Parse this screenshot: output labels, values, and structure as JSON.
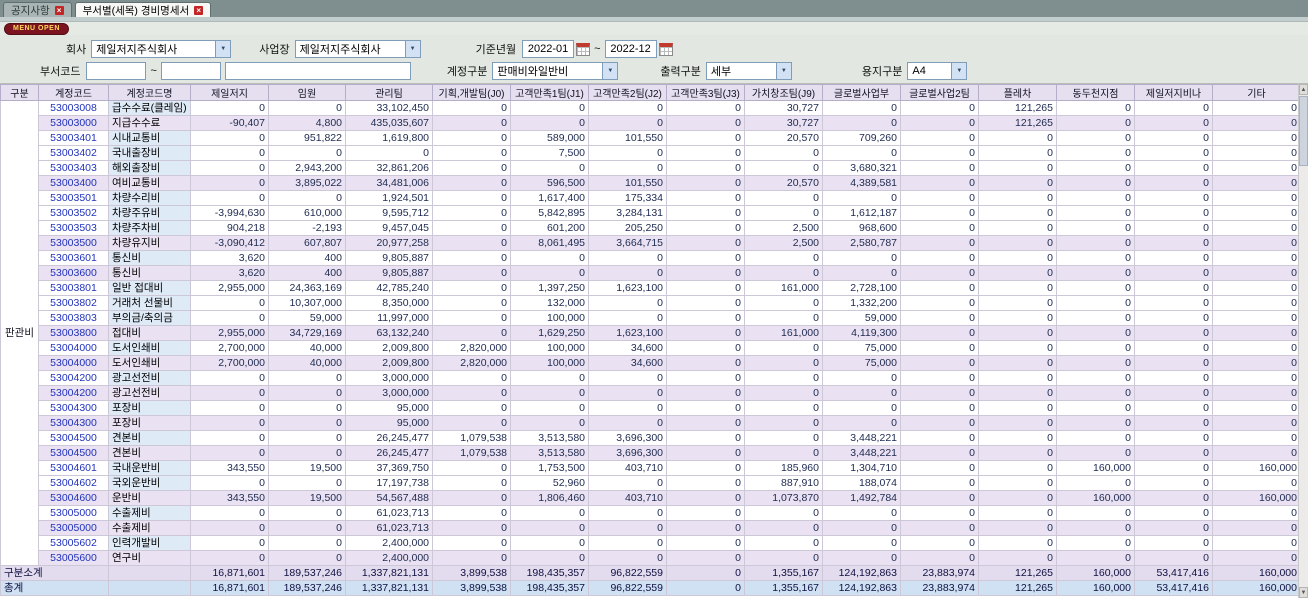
{
  "tabs": [
    {
      "label": "공지사항"
    },
    {
      "label": "부서별(세목) 경비명세서"
    }
  ],
  "menu_button_label": "MENU OPEN",
  "icons": {
    "tab_close": "×",
    "dropdown_arrow": "▼",
    "scroll_up": "▲",
    "scroll_down": "▼"
  },
  "filters": {
    "company_label": "회사",
    "company_value": "제일저지주식회사",
    "workplace_label": "사업장",
    "workplace_value": "제일저지주식회사",
    "period_label": "기준년월",
    "period_from": "2022-01",
    "period_to": "2022-12",
    "tilde": "~",
    "dept_code_label": "부서코드",
    "account_type_label": "계정구분",
    "account_type_value": "판매비와일반비",
    "output_label": "출력구분",
    "output_value": "세부",
    "paper_label": "용지구분",
    "paper_value": "A4"
  },
  "colors": {
    "header_bg": "#e6dff0",
    "sum_row_bg": "#eae2f2",
    "detail_name_bg": "#dfeaf7",
    "subtotal_bg": "#e3dbee",
    "total_bg": "#cfe1f3",
    "code_text": "#2233bb",
    "menu_button_bg": "#7c1420"
  },
  "table": {
    "headers": [
      "구분",
      "계정코드",
      "계정코드명",
      "제일저지",
      "임원",
      "관리팀",
      "기획,개발팀(J0)",
      "고객만족1팀(J1)",
      "고객만족2팀(J2)",
      "고객만족3팀(J3)",
      "가치창조팀(J9)",
      "글로벌사업부",
      "글로벌사업2팀",
      "플레차",
      "동두천지점",
      "제일저지비나",
      "기타"
    ],
    "group_label": "판관비",
    "rows": [
      {
        "code": "53003008",
        "name": "급수수료(클레임)",
        "type": "detail",
        "values": [
          "0",
          "0",
          "33,102,450",
          "0",
          "0",
          "0",
          "0",
          "30,727",
          "0",
          "0",
          "121,265",
          "0",
          "0",
          "0"
        ]
      },
      {
        "code": "53003000",
        "name": "지급수수료",
        "type": "sum",
        "values": [
          "-90,407",
          "4,800",
          "435,035,607",
          "0",
          "0",
          "0",
          "0",
          "30,727",
          "0",
          "0",
          "121,265",
          "0",
          "0",
          "0"
        ]
      },
      {
        "code": "53003401",
        "name": "시내교통비",
        "type": "detail",
        "values": [
          "0",
          "951,822",
          "1,619,800",
          "0",
          "589,000",
          "101,550",
          "0",
          "20,570",
          "709,260",
          "0",
          "0",
          "0",
          "0",
          "0"
        ]
      },
      {
        "code": "53003402",
        "name": "국내출장비",
        "type": "detail",
        "values": [
          "0",
          "0",
          "0",
          "0",
          "7,500",
          "0",
          "0",
          "0",
          "0",
          "0",
          "0",
          "0",
          "0",
          "0"
        ]
      },
      {
        "code": "53003403",
        "name": "해외출장비",
        "type": "detail",
        "values": [
          "0",
          "2,943,200",
          "32,861,206",
          "0",
          "0",
          "0",
          "0",
          "0",
          "3,680,321",
          "0",
          "0",
          "0",
          "0",
          "0"
        ]
      },
      {
        "code": "53003400",
        "name": "여비교통비",
        "type": "sum",
        "values": [
          "0",
          "3,895,022",
          "34,481,006",
          "0",
          "596,500",
          "101,550",
          "0",
          "20,570",
          "4,389,581",
          "0",
          "0",
          "0",
          "0",
          "0"
        ]
      },
      {
        "code": "53003501",
        "name": "차량수리비",
        "type": "detail",
        "values": [
          "0",
          "0",
          "1,924,501",
          "0",
          "1,617,400",
          "175,334",
          "0",
          "0",
          "0",
          "0",
          "0",
          "0",
          "0",
          "0"
        ]
      },
      {
        "code": "53003502",
        "name": "차량주유비",
        "type": "detail",
        "values": [
          "-3,994,630",
          "610,000",
          "9,595,712",
          "0",
          "5,842,895",
          "3,284,131",
          "0",
          "0",
          "1,612,187",
          "0",
          "0",
          "0",
          "0",
          "0"
        ]
      },
      {
        "code": "53003503",
        "name": "차량주차비",
        "type": "detail",
        "values": [
          "904,218",
          "-2,193",
          "9,457,045",
          "0",
          "601,200",
          "205,250",
          "0",
          "2,500",
          "968,600",
          "0",
          "0",
          "0",
          "0",
          "0"
        ]
      },
      {
        "code": "53003500",
        "name": "차량유지비",
        "type": "sum",
        "values": [
          "-3,090,412",
          "607,807",
          "20,977,258",
          "0",
          "8,061,495",
          "3,664,715",
          "0",
          "2,500",
          "2,580,787",
          "0",
          "0",
          "0",
          "0",
          "0"
        ]
      },
      {
        "code": "53003601",
        "name": "통신비",
        "type": "detail",
        "values": [
          "3,620",
          "400",
          "9,805,887",
          "0",
          "0",
          "0",
          "0",
          "0",
          "0",
          "0",
          "0",
          "0",
          "0",
          "0"
        ]
      },
      {
        "code": "53003600",
        "name": "통신비",
        "type": "sum",
        "values": [
          "3,620",
          "400",
          "9,805,887",
          "0",
          "0",
          "0",
          "0",
          "0",
          "0",
          "0",
          "0",
          "0",
          "0",
          "0"
        ]
      },
      {
        "code": "53003801",
        "name": "일반 접대비",
        "type": "detail",
        "values": [
          "2,955,000",
          "24,363,169",
          "42,785,240",
          "0",
          "1,397,250",
          "1,623,100",
          "0",
          "161,000",
          "2,728,100",
          "0",
          "0",
          "0",
          "0",
          "0"
        ]
      },
      {
        "code": "53003802",
        "name": "거래처 선물비",
        "type": "detail",
        "values": [
          "0",
          "10,307,000",
          "8,350,000",
          "0",
          "132,000",
          "0",
          "0",
          "0",
          "1,332,200",
          "0",
          "0",
          "0",
          "0",
          "0"
        ]
      },
      {
        "code": "53003803",
        "name": "부의금/축의금",
        "type": "detail",
        "values": [
          "0",
          "59,000",
          "11,997,000",
          "0",
          "100,000",
          "0",
          "0",
          "0",
          "59,000",
          "0",
          "0",
          "0",
          "0",
          "0"
        ]
      },
      {
        "code": "53003800",
        "name": "접대비",
        "type": "sum",
        "values": [
          "2,955,000",
          "34,729,169",
          "63,132,240",
          "0",
          "1,629,250",
          "1,623,100",
          "0",
          "161,000",
          "4,119,300",
          "0",
          "0",
          "0",
          "0",
          "0"
        ]
      },
      {
        "code": "53004000",
        "name": "도서인쇄비",
        "type": "detail",
        "values": [
          "2,700,000",
          "40,000",
          "2,009,800",
          "2,820,000",
          "100,000",
          "34,600",
          "0",
          "0",
          "75,000",
          "0",
          "0",
          "0",
          "0",
          "0"
        ]
      },
      {
        "code": "53004000",
        "name": "도서인쇄비",
        "type": "sum",
        "values": [
          "2,700,000",
          "40,000",
          "2,009,800",
          "2,820,000",
          "100,000",
          "34,600",
          "0",
          "0",
          "75,000",
          "0",
          "0",
          "0",
          "0",
          "0"
        ]
      },
      {
        "code": "53004200",
        "name": "광고선전비",
        "type": "detail",
        "values": [
          "0",
          "0",
          "3,000,000",
          "0",
          "0",
          "0",
          "0",
          "0",
          "0",
          "0",
          "0",
          "0",
          "0",
          "0"
        ]
      },
      {
        "code": "53004200",
        "name": "광고선전비",
        "type": "sum",
        "values": [
          "0",
          "0",
          "3,000,000",
          "0",
          "0",
          "0",
          "0",
          "0",
          "0",
          "0",
          "0",
          "0",
          "0",
          "0"
        ]
      },
      {
        "code": "53004300",
        "name": "포장비",
        "type": "detail",
        "values": [
          "0",
          "0",
          "95,000",
          "0",
          "0",
          "0",
          "0",
          "0",
          "0",
          "0",
          "0",
          "0",
          "0",
          "0"
        ]
      },
      {
        "code": "53004300",
        "name": "포장비",
        "type": "sum",
        "values": [
          "0",
          "0",
          "95,000",
          "0",
          "0",
          "0",
          "0",
          "0",
          "0",
          "0",
          "0",
          "0",
          "0",
          "0"
        ]
      },
      {
        "code": "53004500",
        "name": "견본비",
        "type": "detail",
        "values": [
          "0",
          "0",
          "26,245,477",
          "1,079,538",
          "3,513,580",
          "3,696,300",
          "0",
          "0",
          "3,448,221",
          "0",
          "0",
          "0",
          "0",
          "0"
        ]
      },
      {
        "code": "53004500",
        "name": "견본비",
        "type": "sum",
        "values": [
          "0",
          "0",
          "26,245,477",
          "1,079,538",
          "3,513,580",
          "3,696,300",
          "0",
          "0",
          "3,448,221",
          "0",
          "0",
          "0",
          "0",
          "0"
        ]
      },
      {
        "code": "53004601",
        "name": "국내운반비",
        "type": "detail",
        "values": [
          "343,550",
          "19,500",
          "37,369,750",
          "0",
          "1,753,500",
          "403,710",
          "0",
          "185,960",
          "1,304,710",
          "0",
          "0",
          "160,000",
          "0",
          "160,000"
        ]
      },
      {
        "code": "53004602",
        "name": "국외운반비",
        "type": "detail",
        "values": [
          "0",
          "0",
          "17,197,738",
          "0",
          "52,960",
          "0",
          "0",
          "887,910",
          "188,074",
          "0",
          "0",
          "0",
          "0",
          "0"
        ]
      },
      {
        "code": "53004600",
        "name": "운반비",
        "type": "sum",
        "values": [
          "343,550",
          "19,500",
          "54,567,488",
          "0",
          "1,806,460",
          "403,710",
          "0",
          "1,073,870",
          "1,492,784",
          "0",
          "0",
          "160,000",
          "0",
          "160,000"
        ]
      },
      {
        "code": "53005000",
        "name": "수출제비",
        "type": "detail",
        "values": [
          "0",
          "0",
          "61,023,713",
          "0",
          "0",
          "0",
          "0",
          "0",
          "0",
          "0",
          "0",
          "0",
          "0",
          "0"
        ]
      },
      {
        "code": "53005000",
        "name": "수출제비",
        "type": "sum",
        "values": [
          "0",
          "0",
          "61,023,713",
          "0",
          "0",
          "0",
          "0",
          "0",
          "0",
          "0",
          "0",
          "0",
          "0",
          "0"
        ]
      },
      {
        "code": "53005602",
        "name": "인력개발비",
        "type": "detail",
        "values": [
          "0",
          "0",
          "2,400,000",
          "0",
          "0",
          "0",
          "0",
          "0",
          "0",
          "0",
          "0",
          "0",
          "0",
          "0"
        ]
      },
      {
        "code": "53005600",
        "name": "연구비",
        "type": "sum",
        "values": [
          "0",
          "0",
          "2,400,000",
          "0",
          "0",
          "0",
          "0",
          "0",
          "0",
          "0",
          "0",
          "0",
          "0",
          "0"
        ]
      }
    ],
    "subtotal": {
      "label": "구분소계",
      "values": [
        "16,871,601",
        "189,537,246",
        "1,337,821,131",
        "3,899,538",
        "198,435,357",
        "96,822,559",
        "0",
        "1,355,167",
        "124,192,863",
        "23,883,974",
        "121,265",
        "160,000",
        "53,417,416",
        "160,000"
      ]
    },
    "total": {
      "label": "총계",
      "values": [
        "16,871,601",
        "189,537,246",
        "1,337,821,131",
        "3,899,538",
        "198,435,357",
        "96,822,559",
        "0",
        "1,355,167",
        "124,192,863",
        "23,883,974",
        "121,265",
        "160,000",
        "53,417,416",
        "160,000"
      ]
    }
  }
}
